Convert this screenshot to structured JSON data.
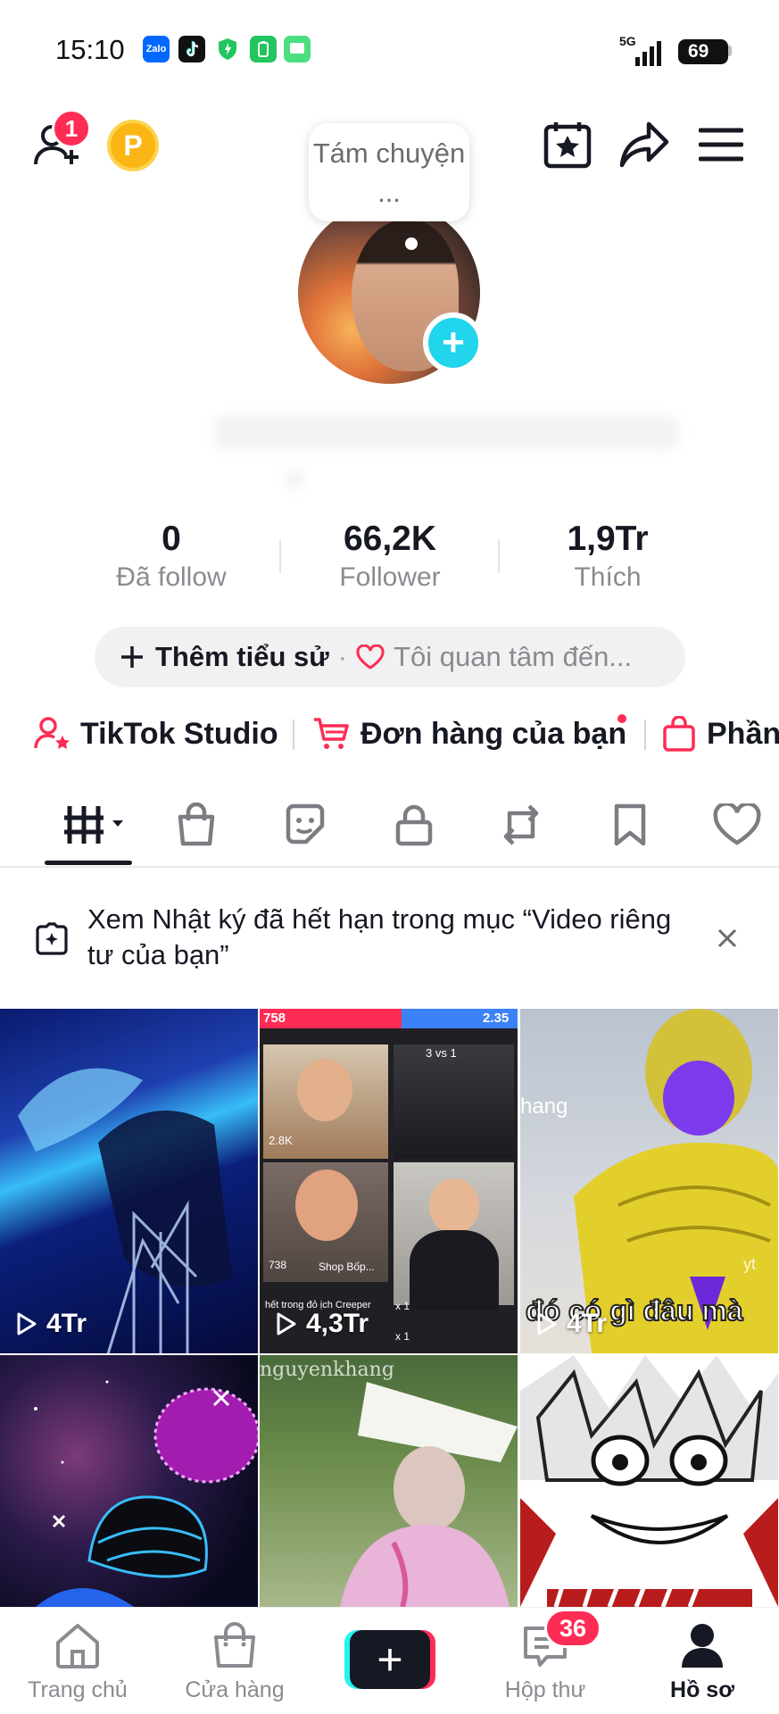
{
  "status_bar": {
    "time": "15:10",
    "app_icons": [
      "zalo-icon",
      "tiktok-icon",
      "shield-icon",
      "battery-saver-icon",
      "chat-icon"
    ],
    "app_labels": {
      "zalo": "Zalo"
    },
    "network": "5G",
    "battery": "69"
  },
  "header": {
    "friend_request_count": "1",
    "coin_label": "P",
    "tooltip_text": "Tám chuyện ...",
    "icons": [
      "add-friend-icon",
      "coin-icon",
      "calendar-star-icon",
      "share-icon",
      "menu-icon"
    ]
  },
  "stats": [
    {
      "value": "0",
      "label": "Đã follow"
    },
    {
      "value": "66,2K",
      "label": "Follower"
    },
    {
      "value": "1,9Tr",
      "label": "Thích"
    }
  ],
  "bio": {
    "add_bio": "Thêm tiểu sử",
    "separator": "·",
    "interest": "Tôi quan tâm đến..."
  },
  "shortcuts": [
    {
      "label": "TikTok Studio",
      "icon": "user-star-icon",
      "color": "#fe2c55"
    },
    {
      "label": "Đơn hàng của bạn",
      "icon": "cart-icon",
      "color": "#fe2c55"
    },
    {
      "label": "Phần",
      "icon": "bag-icon",
      "color": "#fe2c55"
    }
  ],
  "tabs": [
    "videos-grid-tab",
    "shop-tab",
    "stickers-tab",
    "private-tab",
    "reposts-tab",
    "favorites-tab",
    "liked-tab"
  ],
  "notice": {
    "text": "Xem Nhật ký đã hết hạn trong mục “Video riêng tư của bạn”"
  },
  "videos": [
    {
      "views": "4Tr"
    },
    {
      "views": "4,3Tr",
      "overlay_texts": [
        "758",
        "2.35",
        "3 vs 1",
        "2.8K",
        "738",
        "Shop Bốp...",
        "hết trong đỏ ịch Creeper",
        "x 1",
        "x 1"
      ]
    },
    {
      "views": "4Tr",
      "overlay_texts": [
        "hang",
        "đó có gì đâu mà",
        "yt"
      ]
    },
    {
      "views": ""
    },
    {
      "views": "",
      "overlay_texts": [
        "nguyenkhang"
      ]
    },
    {
      "views": ""
    }
  ],
  "bottom_nav": [
    {
      "label": "Trang chủ",
      "icon": "home-icon"
    },
    {
      "label": "Cửa hàng",
      "icon": "shop-icon"
    },
    {
      "label": "",
      "icon": "create-icon"
    },
    {
      "label": "Hộp thư",
      "icon": "inbox-icon",
      "badge": "36"
    },
    {
      "label": "Hồ sơ",
      "icon": "profile-icon",
      "active": true
    }
  ],
  "colors": {
    "accent": "#fe2c55",
    "cyan": "#25f4ee",
    "text": "#161823",
    "muted": "#8a8b91"
  }
}
